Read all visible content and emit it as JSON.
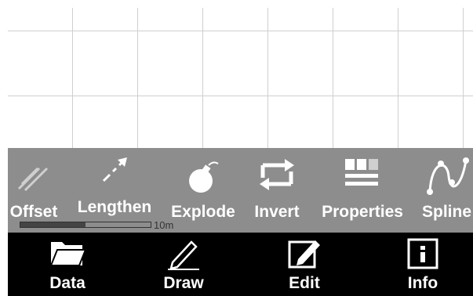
{
  "tools": [
    {
      "label": "Offset",
      "icon": "offset-icon"
    },
    {
      "label": "Lengthen",
      "icon": "lengthen-icon"
    },
    {
      "label": "Explode",
      "icon": "bomb-icon"
    },
    {
      "label": "Invert",
      "icon": "invert-arrows-icon"
    },
    {
      "label": "Properties",
      "icon": "properties-icon"
    },
    {
      "label": "Spline",
      "icon": "spline-icon"
    }
  ],
  "scale": {
    "label": "10m",
    "fill_fraction": 0.5
  },
  "tabs": [
    {
      "label": "Data",
      "icon": "folder-icon"
    },
    {
      "label": "Draw",
      "icon": "pencil-icon"
    },
    {
      "label": "Edit",
      "icon": "edit-icon"
    },
    {
      "label": "Info",
      "icon": "info-icon"
    }
  ],
  "colors": {
    "toolbar_bg": "#8d8d8d",
    "tabbar_bg": "#000000",
    "grid": "#cfcfcf"
  }
}
